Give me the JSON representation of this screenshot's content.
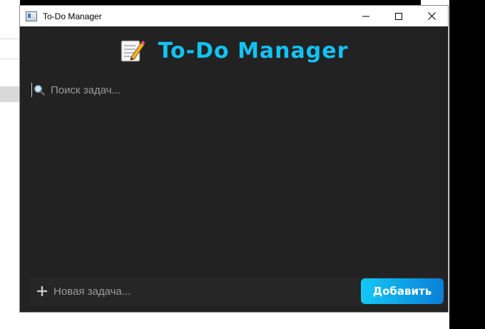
{
  "window": {
    "title": "To-Do Manager",
    "controls": [
      "minimize",
      "maximize",
      "close"
    ]
  },
  "header": {
    "icon": "memo-icon",
    "title": "To-Do Manager"
  },
  "search": {
    "icon": "magnifier-icon",
    "placeholder": "Поиск задач...",
    "value": ""
  },
  "tasks": [],
  "new_task": {
    "icon": "plus-icon",
    "placeholder": "Новая задача...",
    "value": ""
  },
  "add_button": {
    "label": "Добавить"
  },
  "colors": {
    "background": "#222222",
    "accent": "#12c2f3",
    "button_gradient_start": "#14c8f6",
    "button_gradient_end": "#0a7fd8",
    "placeholder": "#9a9a9a"
  }
}
